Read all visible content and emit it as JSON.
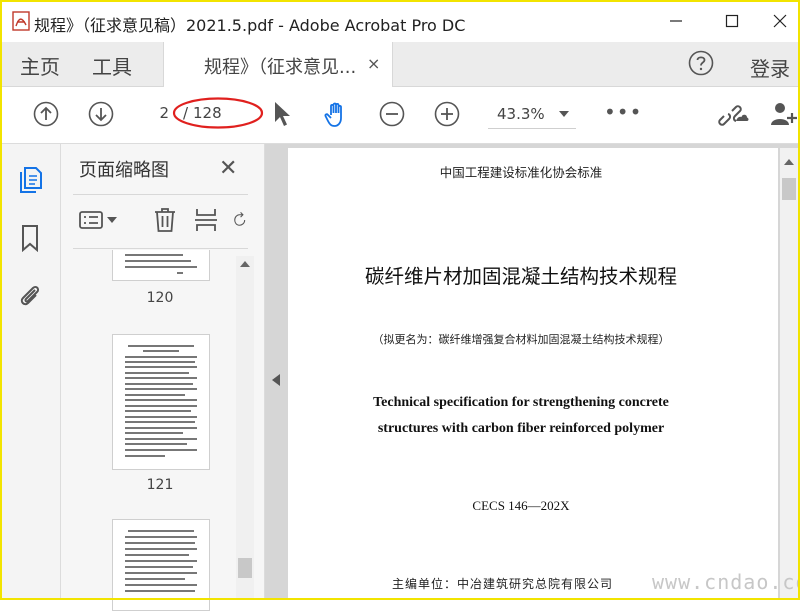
{
  "window": {
    "title": "规程》（征求意见稿）2021.5.pdf - Adobe Acrobat Pro DC",
    "icon": "acrobat-icon"
  },
  "menu": {
    "home": "主页",
    "tools": "工具",
    "tab_label": "规程》（征求意见...",
    "tab_close": "×",
    "login": "登录"
  },
  "toolbar": {
    "current_page": "2",
    "page_separator": "/",
    "total_pages": "128",
    "zoom": "43.3%",
    "more": "•••"
  },
  "panel": {
    "title": "页面缩略图",
    "close": "✕",
    "thumbnails": [
      {
        "page": "120"
      },
      {
        "page": "121"
      }
    ]
  },
  "document": {
    "organization": "中国工程建设标准化协会标准",
    "title": "碳纤维片材加固混凝土结构技术规程",
    "subtitle": "（拟更名为：碳纤维增强复合材料加固混凝土结构技术规程）",
    "english_title_line1": "Technical specification for strengthening concrete",
    "english_title_line2": "structures with carbon fiber reinforced polymer",
    "code": "CECS 146—202X",
    "editor_unit": "主编单位：中冶建筑研究总院有限公司"
  },
  "watermark": "www.cndao.com",
  "colors": {
    "accent_blue": "#1473e6",
    "annotation_red": "#e0201e",
    "frame_yellow": "#f2e400"
  }
}
